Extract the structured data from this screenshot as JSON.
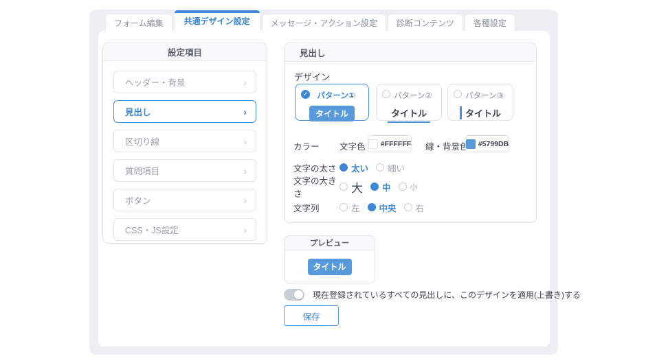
{
  "accent_color": "#3d87d8",
  "button_color": "#5799DB",
  "icons": {
    "check": "✓",
    "chevron_right": "›"
  },
  "tabs": [
    {
      "label": "フォーム編集",
      "active": false
    },
    {
      "label": "共通デザイン設定",
      "active": true
    },
    {
      "label": "メッセージ・アクション設定",
      "active": false
    },
    {
      "label": "診断コンテンツ",
      "active": false
    },
    {
      "label": "各種設定",
      "active": false
    }
  ],
  "sidebar": {
    "title": "設定項目",
    "items": [
      {
        "label": "ヘッダー・背景",
        "selected": false
      },
      {
        "label": "見出し",
        "selected": true
      },
      {
        "label": "区切り線",
        "selected": false
      },
      {
        "label": "質問項目",
        "selected": false
      },
      {
        "label": "ボタン",
        "selected": false
      },
      {
        "label": "CSS・JS設定",
        "selected": false
      }
    ]
  },
  "panel": {
    "title": "見出し",
    "design_label": "デザイン",
    "patterns": [
      {
        "label": "パターン①",
        "sample": "タイトル",
        "selected": true
      },
      {
        "label": "パターン②",
        "sample": "タイトル",
        "selected": false
      },
      {
        "label": "パターン③",
        "sample": "タイトル",
        "selected": false
      }
    ],
    "color": {
      "label": "カラー",
      "text_color_label": "文字色",
      "text_color_value": "#FFFFFF",
      "line_bg_label": "線・背景色",
      "line_bg_value": "#5799DB"
    },
    "weight": {
      "label": "文字の太さ",
      "options": [
        {
          "label": "太い",
          "selected": true
        },
        {
          "label": "細い",
          "selected": false
        }
      ]
    },
    "size": {
      "label": "文字の大きさ",
      "options": [
        {
          "label": "大",
          "selected": false
        },
        {
          "label": "中",
          "selected": true
        },
        {
          "label": "小",
          "selected": false
        }
      ]
    },
    "align": {
      "label": "文字列",
      "options": [
        {
          "label": "左",
          "selected": false
        },
        {
          "label": "中央",
          "selected": true
        },
        {
          "label": "右",
          "selected": false
        }
      ]
    }
  },
  "preview": {
    "title": "プレビュー",
    "sample": "タイトル"
  },
  "apply_toggle": {
    "on": false,
    "label": "現在登録されているすべての見出しに、このデザインを適用(上書き)する"
  },
  "save_label": "保存"
}
